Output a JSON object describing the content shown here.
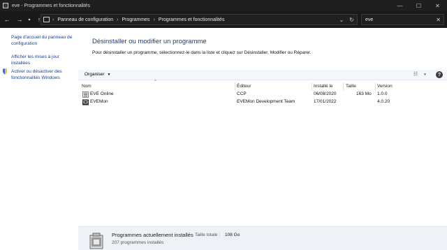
{
  "window": {
    "title": "eve - Programmes et fonctionnalités",
    "controls": [
      "—",
      "☐",
      "✕"
    ]
  },
  "navigation": {
    "back_icon": "arrow-left-icon",
    "forward_icon": "arrow-right-icon",
    "recent_icon": "chevron-down-icon",
    "up_icon": "arrow-up-icon",
    "breadcrumbs": [
      "Panneau de configuration",
      "Programmes",
      "Programmes et fonctionnalités"
    ],
    "search_value": "eve"
  },
  "sidebar": {
    "links": [
      {
        "label_1": "Page d'accueil du panneau de",
        "label_2": "configuration"
      },
      {
        "label_1": "Afficher les mises à jour",
        "label_2": "installées"
      },
      {
        "label_1": "Activer ou désactiver des",
        "label_2": "fonctionnalités Windows"
      }
    ]
  },
  "main": {
    "heading": "Désinstaller ou modifier un programme",
    "description": "Pour désinstaller un programme, sélectionnez-le dans la liste et cliquez sur Désinstaller, Modifier ou Réparer."
  },
  "toolbar": {
    "organise_label": "Organiser"
  },
  "table": {
    "columns": [
      "Nom",
      "Éditeur",
      "Installé le",
      "Taille",
      "Version"
    ],
    "rows": [
      {
        "name": "EVE Online",
        "publisher": "CCP",
        "installed": "06/08/2020",
        "size": "163 Mo",
        "version": "1.0.0"
      },
      {
        "name": "EVEMon",
        "publisher": "EVEMon Development Team",
        "installed": "17/01/2022",
        "size": "",
        "version": "4.0.20"
      }
    ]
  },
  "details": {
    "title": "Programmes actuellement installés",
    "total_label": "Taille totale :",
    "total_value": "108 Go",
    "count": "207 programmes installés"
  },
  "colors": {
    "heading": "#1e3a8a",
    "link": "#1a3e8a",
    "titlebar": "#1f1f1f"
  }
}
